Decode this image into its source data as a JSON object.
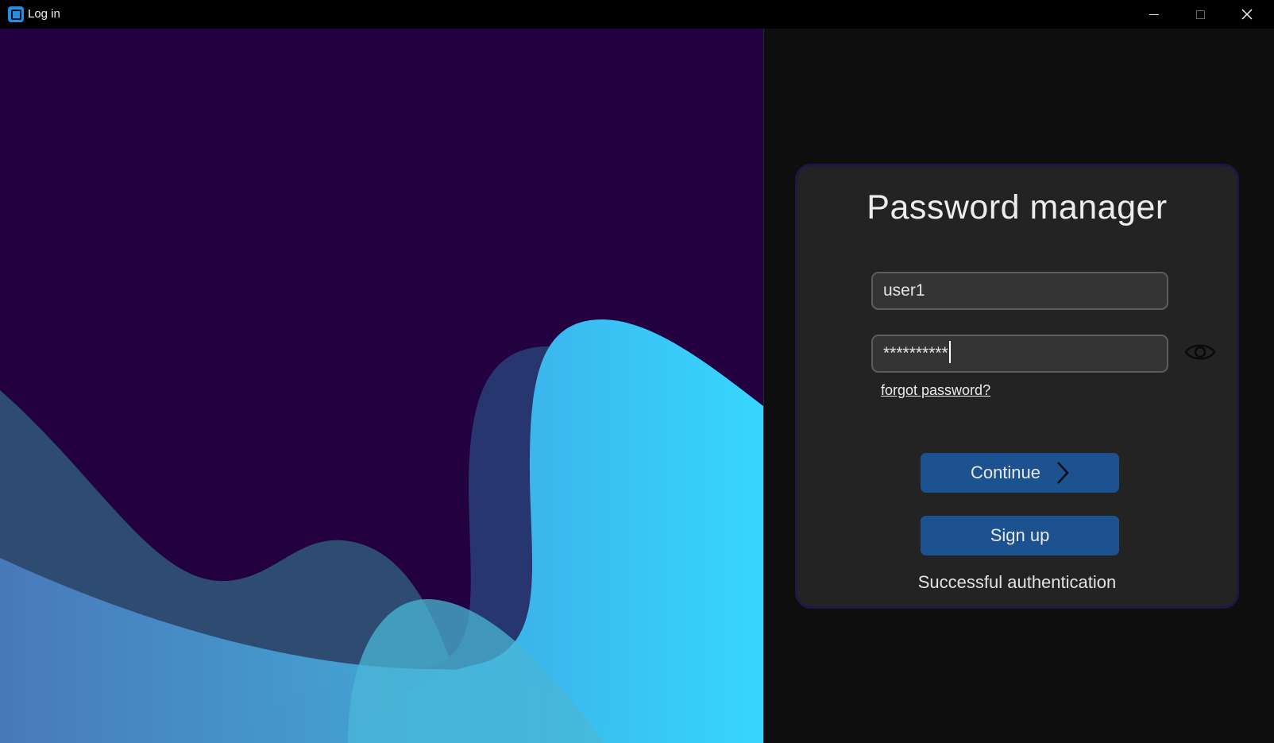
{
  "window": {
    "title": "Log in",
    "controls": [
      "minimize",
      "maximize",
      "close"
    ]
  },
  "login": {
    "heading": "Password manager",
    "username_value": "user1",
    "password_value": "**********",
    "show_password_icon": "eye-icon",
    "forgot_password_label": "forgot password?",
    "continue_label": "Continue",
    "continue_icon": "chevron-right-icon",
    "signup_label": "Sign up",
    "status": "Successful authentication"
  },
  "colors": {
    "art_background": "#23003f",
    "card_background": "#232323",
    "button_blue": "#1d5290",
    "accent_cyan": "#36d4ff"
  }
}
